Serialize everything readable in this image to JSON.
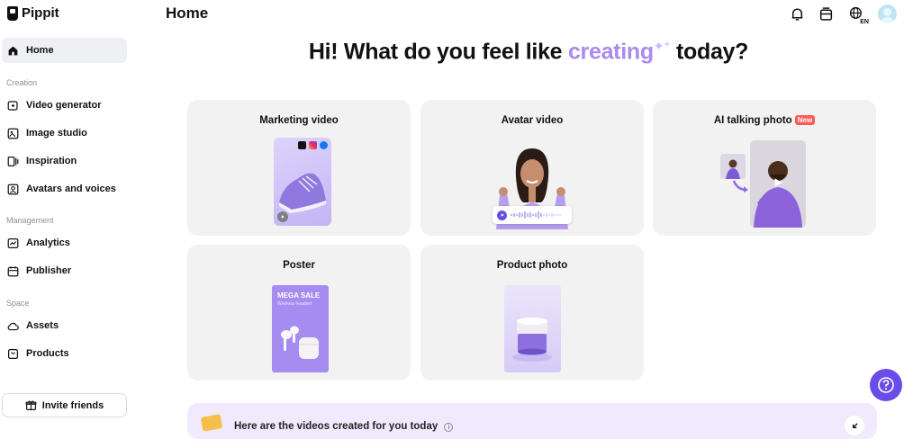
{
  "app": {
    "name": "Pippit"
  },
  "header": {
    "title": "Home"
  },
  "sidebar": {
    "home": "Home",
    "sections": [
      {
        "label": "Creation",
        "items": [
          "Video generator",
          "Image studio",
          "Inspiration",
          "Avatars and voices"
        ]
      },
      {
        "label": "Management",
        "items": [
          "Analytics",
          "Publisher"
        ]
      },
      {
        "label": "Space",
        "items": [
          "Assets",
          "Products"
        ]
      }
    ],
    "invite": "Invite friends"
  },
  "topbar": {
    "icons": [
      "bell-icon",
      "inbox-icon",
      "language-icon",
      "avatar"
    ],
    "language_code": "EN"
  },
  "hero": {
    "prefix": "Hi! What do you feel like",
    "accent": "creating",
    "suffix": "today?"
  },
  "cards": [
    {
      "title": "Marketing video"
    },
    {
      "title": "Avatar video"
    },
    {
      "title": "AI talking photo",
      "badge": "New"
    },
    {
      "title": "Poster"
    },
    {
      "title": "Product photo"
    }
  ],
  "poster": {
    "headline": "MEGA SALE",
    "sub": "Wireless headset"
  },
  "banner": {
    "text": "Here are the videos created for you today"
  },
  "colors": {
    "accent": "#a98bf0",
    "help_button": "#6a4ce8",
    "badge": "#ff5a55"
  }
}
